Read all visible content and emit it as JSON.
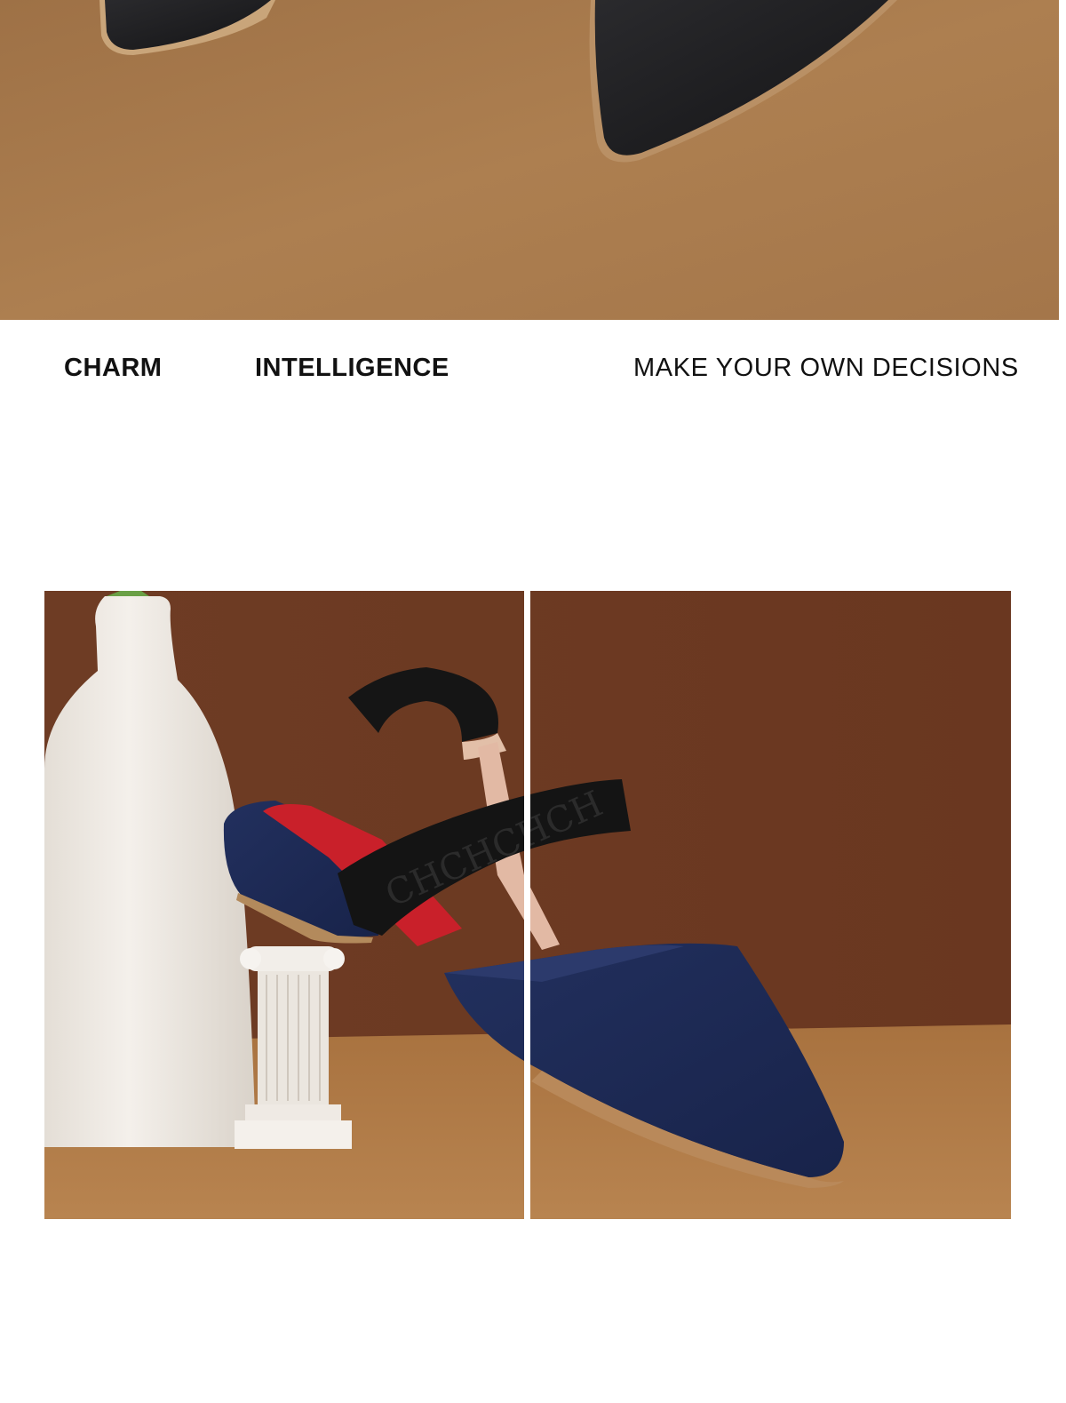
{
  "hero": {
    "image": "shoe-toes-closeup",
    "colors": {
      "background": "#a87a4c",
      "shoe": "#1c1c1e"
    }
  },
  "tagline": {
    "charm": "CHARM",
    "intelligence": "INTELLIGENCE",
    "decisions": "MAKE YOUR OWN DECISIONS"
  },
  "product_photo": {
    "image": "denim-slingback-flat-with-vase-and-column",
    "strap_text": "CHCHCHCH",
    "colors": {
      "wall": "#6b3a22",
      "floor": "#b07a48",
      "denim": "#1d2a55",
      "strap": "#111111",
      "lining": "#d8232a",
      "vase": "#efeae4"
    }
  }
}
